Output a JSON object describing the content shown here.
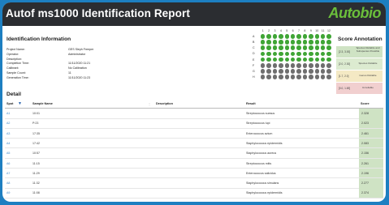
{
  "report": {
    "title": "Autof ms1000 Identification Report",
    "logo": "Autobio"
  },
  "info": {
    "heading": "Identification Information",
    "rows": [
      {
        "label": "Project Name:",
        "value": "GES Sleph Freeper"
      },
      {
        "label": "Operator:",
        "value": "Administrator"
      },
      {
        "label": "Description:",
        "value": ""
      },
      {
        "label": "Completion Time:",
        "value": "11/11/2020 11:21"
      },
      {
        "label": "Calibrant:",
        "value": "No Calibration"
      },
      {
        "label": "Sample Count:",
        "value": "11"
      },
      {
        "label": "Generation Time:",
        "value": "11/11/2020 11:23"
      }
    ]
  },
  "plate": {
    "columns": [
      "1",
      "2",
      "3",
      "4",
      "5",
      "6",
      "7",
      "8",
      "9",
      "10",
      "11",
      "12"
    ],
    "rows": [
      "A",
      "B",
      "C",
      "D",
      "E",
      "F",
      "G",
      "H"
    ],
    "colors": {
      "green": "#3fa535",
      "gray": "#6e6e6e"
    },
    "layout": [
      "gggggggggggg",
      "gggggggggggg",
      "gggggggggggg",
      "gggggggggggg",
      "gggggggggggg",
      "kkkkkkkkkkkk",
      "kkkkkkkkkkkk",
      "kkkkkkkkkkkk"
    ]
  },
  "score_annotation": {
    "heading": "Score Annotation",
    "items": [
      {
        "range": "[2.3, 3.00]",
        "meaning": "Species Reliable and Subspecies Possible",
        "color": "#cfe3c4"
      },
      {
        "range": "[2.0, 2.30]",
        "meaning": "Species Reliable",
        "color": "#dcebd0"
      },
      {
        "range": "[1.7, 2.0]",
        "meaning": "Genus Reliable",
        "color": "#f4e9c4"
      },
      {
        "range": "[0.0, 1.69]",
        "meaning": "Unreliable",
        "color": "#f1cfcf"
      }
    ]
  },
  "detail": {
    "heading": "Detail",
    "columns": {
      "spot": "Spot",
      "sample": "Sample Name",
      "description": "Description",
      "result": "Result",
      "score": "Score"
    },
    "rows": [
      {
        "spot": "A1",
        "sample": "10:01",
        "description": "",
        "result": "Streptococcus suesus",
        "score": "2.328"
      },
      {
        "spot": "A2",
        "sample": "P:23",
        "description": "",
        "result": "Streptococcus lupi",
        "score": "2.023"
      },
      {
        "spot": "A3",
        "sample": "17:35",
        "description": "",
        "result": "Enterococcus avium",
        "score": "2.461"
      },
      {
        "spot": "A4",
        "sample": "17:42",
        "description": "",
        "result": "Staphylococcus epidermidis",
        "score": "2.083"
      },
      {
        "spot": "A5",
        "sample": "10:57",
        "description": "",
        "result": "Staphylococcus aureus",
        "score": "2.156"
      },
      {
        "spot": "A6",
        "sample": "11:15",
        "description": "",
        "result": "Streptococcus mitis",
        "score": "2.261"
      },
      {
        "spot": "A7",
        "sample": "11:29",
        "description": "",
        "result": "Enterococcus salicidus",
        "score": "2.196"
      },
      {
        "spot": "A8",
        "sample": "11:32",
        "description": "",
        "result": "Staphylococcus simulans",
        "score": "2.277"
      },
      {
        "spot": "A9",
        "sample": "11:08",
        "description": "",
        "result": "Staphylococcus epidermidis",
        "score": "2.374"
      }
    ]
  }
}
